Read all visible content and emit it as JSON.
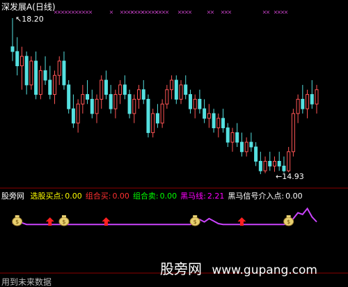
{
  "main_panel": {
    "title": "深发展A(日线)",
    "high_label": "18.20",
    "low_label": "←14.93",
    "high_arrow": "↖",
    "marker_glyph": "×"
  },
  "indicator_panel": {
    "name": "股旁网",
    "fields": [
      {
        "label": "选股买点:",
        "value": "0.00",
        "color": "#ffff00"
      },
      {
        "label": "组合买:",
        "value": "0.00",
        "color": "#ff3030"
      },
      {
        "label": "组合卖:",
        "value": "0.00",
        "color": "#00ff00"
      },
      {
        "label": "黑马线:",
        "value": "2.21",
        "color": "#ff00ff"
      },
      {
        "label": "黑马信号介入点:",
        "value": "0.00",
        "color": "#ffffff"
      }
    ],
    "bag_glyph": "$"
  },
  "watermark": {
    "brand": "股旁网",
    "url": "www.gupang.com"
  },
  "footer_text": "用到未来数据",
  "colors": {
    "up": "#ff5555",
    "down": "#55e0e0",
    "marker": "#cc44cc",
    "line": "#cc44ff",
    "bag": "#e8d070",
    "arrow": "#ff2020"
  },
  "chart_data": {
    "type": "candlestick",
    "title": "深发展A(日线)",
    "ohlc_scale_note": "prices estimated from chart; high 18.20, low 14.93",
    "candles": [
      [
        17.6,
        18.2,
        17.3,
        17.5
      ],
      [
        17.5,
        17.8,
        17.0,
        17.2
      ],
      [
        17.2,
        17.6,
        16.7,
        17.4
      ],
      [
        17.4,
        17.5,
        16.6,
        16.8
      ],
      [
        16.8,
        17.4,
        16.7,
        17.3
      ],
      [
        17.3,
        17.5,
        16.5,
        16.6
      ],
      [
        16.6,
        17.2,
        16.5,
        17.1
      ],
      [
        17.1,
        17.4,
        16.8,
        16.9
      ],
      [
        16.9,
        17.2,
        16.5,
        16.6
      ],
      [
        16.6,
        17.1,
        16.4,
        17.0
      ],
      [
        17.0,
        17.4,
        16.8,
        17.3
      ],
      [
        17.3,
        17.5,
        16.7,
        16.8
      ],
      [
        16.8,
        16.9,
        16.2,
        16.3
      ],
      [
        16.3,
        16.6,
        15.9,
        16.0
      ],
      [
        16.0,
        16.5,
        15.8,
        16.4
      ],
      [
        16.4,
        16.8,
        16.2,
        16.6
      ],
      [
        16.6,
        16.9,
        16.4,
        16.5
      ],
      [
        16.5,
        16.7,
        16.1,
        16.2
      ],
      [
        16.2,
        16.6,
        16.0,
        16.5
      ],
      [
        16.5,
        17.0,
        16.3,
        16.9
      ],
      [
        16.9,
        17.1,
        16.5,
        16.6
      ],
      [
        16.6,
        16.8,
        16.2,
        16.3
      ],
      [
        16.3,
        16.7,
        16.1,
        16.6
      ],
      [
        16.6,
        16.9,
        16.4,
        16.8
      ],
      [
        16.8,
        17.0,
        16.5,
        16.6
      ],
      [
        16.6,
        16.7,
        16.1,
        16.2
      ],
      [
        16.2,
        16.6,
        16.0,
        16.5
      ],
      [
        16.5,
        16.8,
        16.3,
        16.7
      ],
      [
        16.7,
        16.9,
        16.4,
        16.5
      ],
      [
        16.5,
        16.6,
        15.7,
        15.8
      ],
      [
        15.8,
        16.3,
        15.7,
        16.2
      ],
      [
        16.2,
        16.4,
        15.9,
        16.0
      ],
      [
        16.0,
        16.5,
        15.9,
        16.4
      ],
      [
        16.4,
        16.8,
        16.3,
        16.7
      ],
      [
        16.7,
        17.0,
        16.5,
        16.9
      ],
      [
        16.9,
        17.0,
        16.4,
        16.5
      ],
      [
        16.5,
        16.9,
        16.4,
        16.8
      ],
      [
        16.8,
        17.0,
        16.5,
        16.6
      ],
      [
        16.6,
        16.7,
        16.2,
        16.3
      ],
      [
        16.3,
        16.6,
        16.1,
        16.5
      ],
      [
        16.5,
        16.7,
        16.2,
        16.3
      ],
      [
        16.3,
        16.5,
        16.0,
        16.1
      ],
      [
        16.1,
        16.4,
        15.9,
        16.2
      ],
      [
        16.2,
        16.3,
        15.8,
        15.9
      ],
      [
        15.9,
        16.2,
        15.7,
        16.1
      ],
      [
        16.1,
        16.3,
        15.8,
        15.9
      ],
      [
        15.9,
        16.0,
        15.5,
        15.6
      ],
      [
        15.6,
        15.9,
        15.4,
        15.8
      ],
      [
        15.8,
        16.0,
        15.5,
        15.6
      ],
      [
        15.6,
        15.8,
        15.3,
        15.4
      ],
      [
        15.4,
        15.7,
        15.3,
        15.6
      ],
      [
        15.6,
        15.8,
        15.4,
        15.5
      ],
      [
        15.5,
        15.6,
        15.1,
        15.2
      ],
      [
        15.2,
        15.4,
        14.93,
        15.0
      ],
      [
        15.0,
        15.3,
        14.95,
        15.2
      ],
      [
        15.2,
        15.4,
        15.0,
        15.1
      ],
      [
        15.1,
        15.3,
        14.98,
        15.2
      ],
      [
        15.2,
        15.4,
        15.0,
        15.1
      ],
      [
        15.1,
        15.3,
        14.96,
        15.0
      ],
      [
        15.0,
        15.5,
        14.97,
        15.4
      ],
      [
        15.4,
        16.3,
        15.3,
        16.2
      ],
      [
        16.2,
        16.6,
        16.0,
        16.5
      ],
      [
        16.5,
        16.8,
        16.2,
        16.3
      ],
      [
        16.3,
        16.7,
        16.1,
        16.6
      ],
      [
        16.6,
        16.9,
        16.3,
        16.4
      ],
      [
        16.4,
        16.8,
        16.2,
        16.7
      ]
    ],
    "black_horse_line": [
      2.0,
      2.9,
      2.1,
      1.9,
      1.9,
      1.9,
      1.9,
      1.9,
      1.9,
      1.9,
      1.9,
      1.9,
      1.9,
      1.9,
      1.9,
      1.9,
      1.9,
      1.9,
      1.9,
      1.9,
      1.9,
      1.9,
      1.9,
      1.9,
      1.9,
      1.9,
      1.9,
      1.9,
      1.9,
      1.9,
      1.9,
      1.9,
      1.9,
      1.9,
      1.9,
      1.9,
      1.9,
      1.9,
      1.9,
      2.1,
      2.5,
      2.2,
      2.6,
      2.3,
      2.0,
      1.9,
      1.9,
      1.9,
      1.9,
      1.9,
      1.9,
      1.9,
      1.9,
      1.9,
      1.9,
      1.9,
      1.9,
      1.9,
      1.9,
      2.0,
      2.6,
      3.3,
      3.1,
      3.8,
      2.8,
      2.21
    ],
    "line_ylim": [
      1.5,
      4.0
    ],
    "bag_signal_indices": [
      1,
      11,
      39,
      59
    ],
    "arrow_signal_indices": [
      8,
      20,
      49
    ]
  }
}
